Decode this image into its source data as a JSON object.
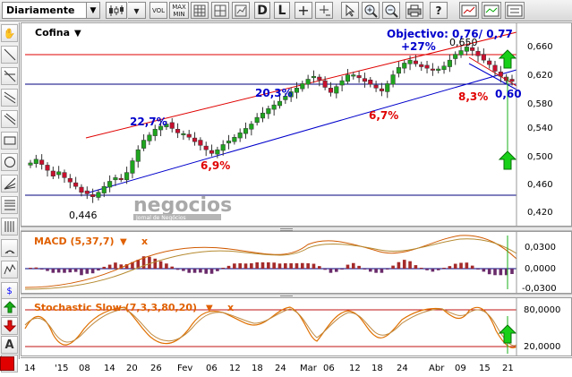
{
  "toolbar": {
    "period": "Diariamente",
    "period_arrow": "▼",
    "vol": "VOL",
    "maxmin": [
      "MAX",
      "MIN"
    ],
    "d_button": "D",
    "l_button": "L"
  },
  "main_chart": {
    "symbol": "Cofina",
    "symbol_arrow": "▼",
    "y_ticks": [
      "0,660",
      "0,620",
      "0,580",
      "0,540",
      "0,500",
      "0,460",
      "0,420"
    ],
    "annotations": {
      "objective": "Objectivo: 0,76/ 0,77",
      "plus27": "+27%",
      "high": "0,650",
      "low": "0,446",
      "pct_22_7": "22,7%",
      "pct_6_9": "6,9%",
      "pct_20_3": "20,3%",
      "pct_6_7": "6,7%",
      "pct_8_3": "8,3%",
      "target_060": "0,60"
    },
    "watermark": "negocios",
    "watermark_sub": "Jornal de Negócios",
    "colors": {
      "up": "#1fa51f",
      "down": "#c8102e",
      "red_line": "#e00000",
      "blue_line": "#0000cc",
      "h_line": "#00007f"
    }
  },
  "macd": {
    "label": "MACD (5,37,7)",
    "label_arrow": "▼",
    "close": "x",
    "y_ticks": [
      "0,0300",
      "0,0000",
      "-0,0300"
    ]
  },
  "stochastic": {
    "label": "Stochastic Slow (7,3,3,80,20)",
    "label_arrow": "▼",
    "close": "x",
    "y_ticks": [
      "80,0000",
      "20,0000"
    ]
  },
  "x_axis": {
    "labels": [
      "14",
      "'15",
      "08",
      "14",
      "20",
      "26",
      "Fev",
      "06",
      "12",
      "18",
      "24",
      "Mar",
      "06",
      "12",
      "18",
      "24",
      "Abr",
      "09",
      "15",
      "21"
    ]
  },
  "chart_data": {
    "type": "candlestick",
    "symbol": "Cofina",
    "ylim": [
      0.42,
      0.67
    ],
    "close": [
      0.492,
      0.497,
      0.49,
      0.482,
      0.474,
      0.48,
      0.472,
      0.466,
      0.46,
      0.452,
      0.45,
      0.446,
      0.452,
      0.46,
      0.467,
      0.472,
      0.47,
      0.479,
      0.495,
      0.51,
      0.523,
      0.53,
      0.538,
      0.542,
      0.545,
      0.539,
      0.533,
      0.532,
      0.527,
      0.521,
      0.516,
      0.51,
      0.505,
      0.51,
      0.517,
      0.522,
      0.527,
      0.533,
      0.539,
      0.545,
      0.554,
      0.56,
      0.566,
      0.571,
      0.576,
      0.583,
      0.589,
      0.594,
      0.6,
      0.606,
      0.61,
      0.605,
      0.595,
      0.588,
      0.596,
      0.604,
      0.612,
      0.612,
      0.608,
      0.603,
      0.599,
      0.594,
      0.59,
      0.6,
      0.612,
      0.622,
      0.628,
      0.632,
      0.627,
      0.623,
      0.621,
      0.619,
      0.62,
      0.624,
      0.632,
      0.64,
      0.645,
      0.65,
      0.645,
      0.638,
      0.632,
      0.626,
      0.617,
      0.61,
      0.604,
      0.603
    ],
    "trendlines": [
      {
        "color": "red",
        "from": [
          0.446,
          0.532
        ],
        "to": [
          0.625,
          0.667
        ]
      },
      {
        "color": "blue",
        "from": [
          0.446,
          0.446
        ],
        "to": [
          0.625,
          0.629
        ]
      },
      {
        "color": "navy",
        "level": 0.608
      },
      {
        "color": "red",
        "level": 0.648
      },
      {
        "color": "navy",
        "level": 0.444
      }
    ]
  }
}
